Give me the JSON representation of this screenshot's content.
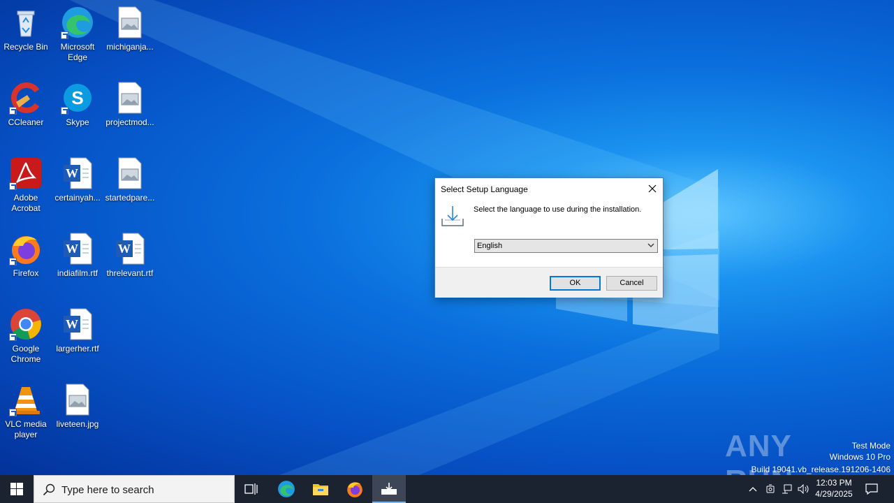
{
  "desktop": {
    "icons": [
      {
        "label": "Recycle Bin",
        "icon": "recycle-bin-icon"
      },
      {
        "label": "Microsoft Edge",
        "icon": "edge-icon"
      },
      {
        "label": "michiganja...",
        "icon": "image-file-icon"
      },
      {
        "label": "CCleaner",
        "icon": "ccleaner-icon"
      },
      {
        "label": "Skype",
        "icon": "skype-icon"
      },
      {
        "label": "projectmod...",
        "icon": "image-file-icon"
      },
      {
        "label": "Adobe Acrobat",
        "icon": "acrobat-icon"
      },
      {
        "label": "certainyah...",
        "icon": "word-doc-icon"
      },
      {
        "label": "startedpare...",
        "icon": "image-file-icon"
      },
      {
        "label": "Firefox",
        "icon": "firefox-icon"
      },
      {
        "label": "indiafilm.rtf",
        "icon": "word-doc-icon"
      },
      {
        "label": "threlevant.rtf",
        "icon": "word-doc-icon"
      },
      {
        "label": "Google Chrome",
        "icon": "chrome-icon"
      },
      {
        "label": "largerher.rtf",
        "icon": "word-doc-icon"
      },
      {
        "label": "VLC media player",
        "icon": "vlc-icon"
      },
      {
        "label": "liveteen.jpg",
        "icon": "image-file-icon"
      }
    ]
  },
  "dialog": {
    "title": "Select Setup Language",
    "message": "Select the language to use during the installation.",
    "selected_language": "English",
    "ok_label": "OK",
    "cancel_label": "Cancel"
  },
  "watermark": {
    "brand": "ANY RUN",
    "line1": "Test Mode",
    "line2": "Windows 10 Pro",
    "line3": "Build 19041.vb_release.191206-1406"
  },
  "taskbar": {
    "search_placeholder": "Type here to search",
    "time": "12:03 PM",
    "date": "4/29/2025"
  },
  "colors": {
    "accent": "#0078d7",
    "taskbar": "#1b2230"
  }
}
